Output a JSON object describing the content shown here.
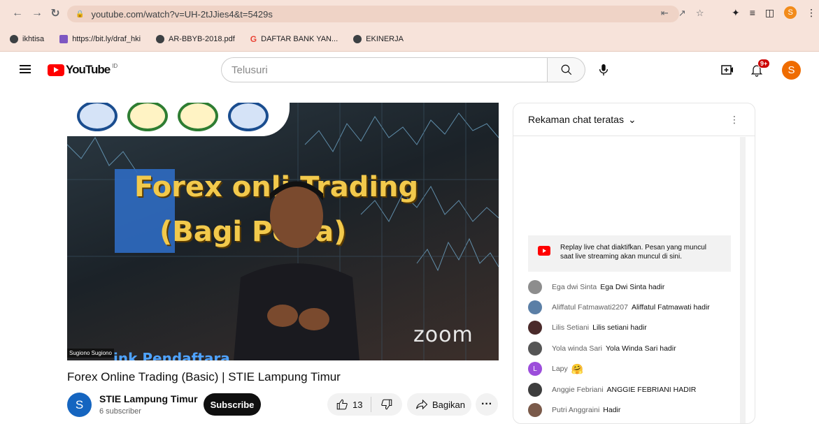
{
  "browser": {
    "url": "youtube.com/watch?v=UH-2tJJies4&t=5429s",
    "profile_initial": "S",
    "bookmarks": [
      {
        "label": "ikhtisa",
        "icon": "globe-icon"
      },
      {
        "label": "https://bit.ly/draf_hki",
        "icon": "sheets-icon"
      },
      {
        "label": "AR-BBYB-2018.pdf",
        "icon": "globe-icon"
      },
      {
        "label": "DAFTAR BANK YAN...",
        "icon": "google-icon"
      },
      {
        "label": "EKINERJA",
        "icon": "globe-icon"
      }
    ]
  },
  "masthead": {
    "logo_text": "YouTube",
    "country_code": "ID",
    "search_placeholder": "Telusuri",
    "notification_count": "9+",
    "avatar_initial": "S"
  },
  "video": {
    "overlay_title": "Forex onli  Trading",
    "overlay_subtitle": "(Bagi Per   a)",
    "zoom_mark": "zoom",
    "speaker_tag": "Sugiono Sugiono",
    "banner_peek": "ink Pendaftara",
    "title": "Forex Online Trading (Basic) | STIE Lampung Timur",
    "channel": {
      "avatar_initial": "S",
      "name": "STIE Lampung Timur",
      "subscribers": "6 subscriber",
      "subscribe_label": "Subscribe"
    },
    "likes": "13",
    "share_label": "Bagikan"
  },
  "chat": {
    "header": "Rekaman chat teratas",
    "notice": "Replay live chat diaktifkan. Pesan yang muncul saat live streaming akan muncul di sini.",
    "messages": [
      {
        "author": "Ega dwi Sinta",
        "text": "Ega Dwi Sinta hadir",
        "avatar_color": "#8d8d8d"
      },
      {
        "author": "Aliffatul Fatmawati2207",
        "text": "Aliffatul Fatmawati hadir",
        "avatar_color": "#5b7fa6"
      },
      {
        "author": "Lilis Setiani",
        "text": "Lilis setiani hadir",
        "avatar_color": "#4a2a2a"
      },
      {
        "author": "Yola winda Sari",
        "text": "Yola Winda Sari hadir",
        "avatar_color": "#555555"
      },
      {
        "author": "Lapy",
        "text": "🤗",
        "avatar_color": "#9c4ddb",
        "avatar_initial": "L"
      },
      {
        "author": "Anggie Febriani",
        "text": "ANGGIE FEBRIANI HADIR",
        "avatar_color": "#3d3d3d"
      },
      {
        "author": "Putri Anggraini",
        "text": "Hadir",
        "avatar_color": "#7a5a4a"
      }
    ]
  }
}
